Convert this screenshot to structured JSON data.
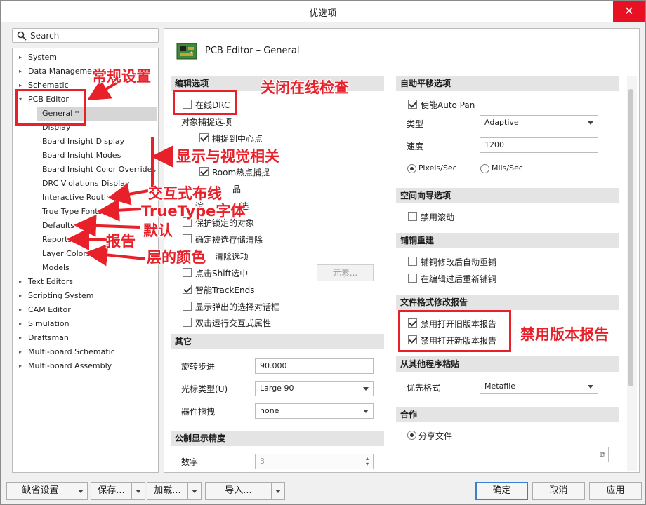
{
  "window": {
    "title": "优选项",
    "close_glyph": "✕"
  },
  "search": {
    "placeholder": "Search",
    "icon": "search-icon"
  },
  "tree": [
    {
      "label": "System",
      "arrow": "▸"
    },
    {
      "label": "Data Management",
      "arrow": "▸"
    },
    {
      "label": "Schematic",
      "arrow": "▸"
    },
    {
      "label": "PCB Editor",
      "arrow": "▾"
    },
    {
      "label": "General *",
      "arrow": ""
    },
    {
      "label": "Display",
      "arrow": ""
    },
    {
      "label": "Board Insight Display",
      "arrow": ""
    },
    {
      "label": "Board Insight Modes",
      "arrow": ""
    },
    {
      "label": "Board Insight Color Overrides",
      "arrow": ""
    },
    {
      "label": "DRC Violations Display",
      "arrow": ""
    },
    {
      "label": "Interactive Routing",
      "arrow": ""
    },
    {
      "label": "True Type Fonts",
      "arrow": ""
    },
    {
      "label": "Defaults",
      "arrow": ""
    },
    {
      "label": "Reports",
      "arrow": ""
    },
    {
      "label": "Layer Colors",
      "arrow": ""
    },
    {
      "label": "Models",
      "arrow": ""
    },
    {
      "label": "Text Editors",
      "arrow": "▸"
    },
    {
      "label": "Scripting System",
      "arrow": "▸"
    },
    {
      "label": "CAM Editor",
      "arrow": "▸"
    },
    {
      "label": "Simulation",
      "arrow": "▸"
    },
    {
      "label": "Draftsman",
      "arrow": "▸"
    },
    {
      "label": "Multi-board Schematic",
      "arrow": "▸"
    },
    {
      "label": "Multi-board Assembly",
      "arrow": "▸"
    }
  ],
  "page_header": {
    "title": "PCB Editor – General",
    "icon": "pcb-board-icon"
  },
  "edit_options": {
    "header": "编辑选项",
    "online_drc": "在线DRC",
    "snap_header": "对象捕捉选项",
    "snap_center": "捕捉到中心点",
    "room_hotspot": "Room热点捕捉",
    "partial_1": "品",
    "partial_2": "谊",
    "partial_3": "选",
    "protect_locked": "保护锁定的对象",
    "confirm_clear": "确定被选存储清除",
    "clear_sel": "清除选项",
    "shift_click": "点击Shift选中",
    "primitives_btn": "元素...",
    "smart_trackends": "智能TrackEnds",
    "show_popup": "显示弹出的选择对话框",
    "dblclick": "双击运行交互式属性"
  },
  "other": {
    "header": "其它",
    "rotation_label": "旋转步进",
    "rotation_value": "90.000",
    "cursor_label": "光标类型",
    "cursor_underline": "U",
    "cursor_value": "Large 90",
    "drag_label": "器件拖拽",
    "drag_value": "none"
  },
  "metric": {
    "header": "公制显示精度",
    "digits_label": "数字",
    "digits_value": "3"
  },
  "autopan": {
    "header": "自动平移选项",
    "enable": "使能Auto Pan",
    "type_label": "类型",
    "type_value": "Adaptive",
    "speed_label": "速度",
    "speed_value": "1200",
    "unit_1": "Pixels/Sec",
    "unit_2": "Mils/Sec"
  },
  "space_nav": {
    "header": "空间向导选项",
    "disable_roll": "禁用滚动"
  },
  "copper": {
    "header": "铺铜重建",
    "auto_repour": "铺铜修改后自动重铺",
    "repour_after": "在编辑过后重新铺铜"
  },
  "file_format": {
    "header": "文件格式修改报告",
    "disable_old": "禁用打开旧版本报告",
    "disable_new": "禁用打开新版本报告"
  },
  "paste": {
    "header": "从其他程序粘贴",
    "format_label": "优先格式",
    "format_value": "Metafile"
  },
  "collab": {
    "header": "合作",
    "share_file": "分享文件"
  },
  "bottom": {
    "defaults": "缺省设置",
    "save": "保存...",
    "load": "加载...",
    "import": "导入...",
    "ok": "确定",
    "cancel": "取消",
    "apply": "应用"
  },
  "annotations": {
    "general": "常规设置",
    "online_drc_off": "关闭在线检查",
    "display_visual": "显示与视觉相关",
    "interactive": "交互式布线",
    "truetype": "TrueType字体",
    "defaults": "默认",
    "reports": "报告",
    "layer_colors": "层的颜色",
    "disable_reports": "禁用版本报告",
    "color": "#e8202a"
  }
}
